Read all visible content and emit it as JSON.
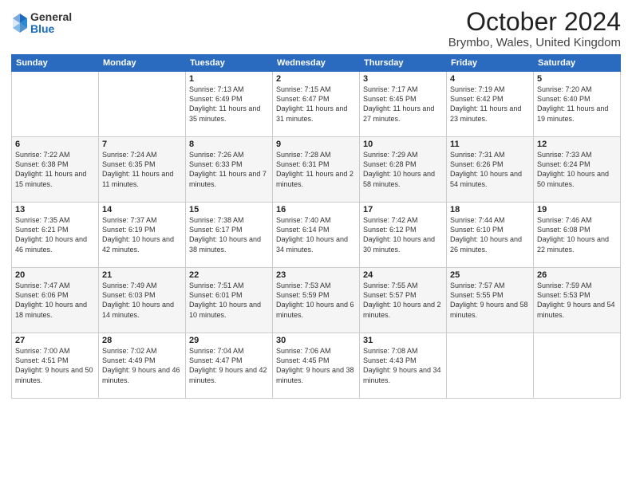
{
  "logo": {
    "general": "General",
    "blue": "Blue"
  },
  "header": {
    "title": "October 2024",
    "location": "Brymbo, Wales, United Kingdom"
  },
  "days": [
    "Sunday",
    "Monday",
    "Tuesday",
    "Wednesday",
    "Thursday",
    "Friday",
    "Saturday"
  ],
  "weeks": [
    [
      {
        "day": "",
        "content": ""
      },
      {
        "day": "",
        "content": ""
      },
      {
        "day": "1",
        "content": "Sunrise: 7:13 AM\nSunset: 6:49 PM\nDaylight: 11 hours and 35 minutes."
      },
      {
        "day": "2",
        "content": "Sunrise: 7:15 AM\nSunset: 6:47 PM\nDaylight: 11 hours and 31 minutes."
      },
      {
        "day": "3",
        "content": "Sunrise: 7:17 AM\nSunset: 6:45 PM\nDaylight: 11 hours and 27 minutes."
      },
      {
        "day": "4",
        "content": "Sunrise: 7:19 AM\nSunset: 6:42 PM\nDaylight: 11 hours and 23 minutes."
      },
      {
        "day": "5",
        "content": "Sunrise: 7:20 AM\nSunset: 6:40 PM\nDaylight: 11 hours and 19 minutes."
      }
    ],
    [
      {
        "day": "6",
        "content": "Sunrise: 7:22 AM\nSunset: 6:38 PM\nDaylight: 11 hours and 15 minutes."
      },
      {
        "day": "7",
        "content": "Sunrise: 7:24 AM\nSunset: 6:35 PM\nDaylight: 11 hours and 11 minutes."
      },
      {
        "day": "8",
        "content": "Sunrise: 7:26 AM\nSunset: 6:33 PM\nDaylight: 11 hours and 7 minutes."
      },
      {
        "day": "9",
        "content": "Sunrise: 7:28 AM\nSunset: 6:31 PM\nDaylight: 11 hours and 2 minutes."
      },
      {
        "day": "10",
        "content": "Sunrise: 7:29 AM\nSunset: 6:28 PM\nDaylight: 10 hours and 58 minutes."
      },
      {
        "day": "11",
        "content": "Sunrise: 7:31 AM\nSunset: 6:26 PM\nDaylight: 10 hours and 54 minutes."
      },
      {
        "day": "12",
        "content": "Sunrise: 7:33 AM\nSunset: 6:24 PM\nDaylight: 10 hours and 50 minutes."
      }
    ],
    [
      {
        "day": "13",
        "content": "Sunrise: 7:35 AM\nSunset: 6:21 PM\nDaylight: 10 hours and 46 minutes."
      },
      {
        "day": "14",
        "content": "Sunrise: 7:37 AM\nSunset: 6:19 PM\nDaylight: 10 hours and 42 minutes."
      },
      {
        "day": "15",
        "content": "Sunrise: 7:38 AM\nSunset: 6:17 PM\nDaylight: 10 hours and 38 minutes."
      },
      {
        "day": "16",
        "content": "Sunrise: 7:40 AM\nSunset: 6:14 PM\nDaylight: 10 hours and 34 minutes."
      },
      {
        "day": "17",
        "content": "Sunrise: 7:42 AM\nSunset: 6:12 PM\nDaylight: 10 hours and 30 minutes."
      },
      {
        "day": "18",
        "content": "Sunrise: 7:44 AM\nSunset: 6:10 PM\nDaylight: 10 hours and 26 minutes."
      },
      {
        "day": "19",
        "content": "Sunrise: 7:46 AM\nSunset: 6:08 PM\nDaylight: 10 hours and 22 minutes."
      }
    ],
    [
      {
        "day": "20",
        "content": "Sunrise: 7:47 AM\nSunset: 6:06 PM\nDaylight: 10 hours and 18 minutes."
      },
      {
        "day": "21",
        "content": "Sunrise: 7:49 AM\nSunset: 6:03 PM\nDaylight: 10 hours and 14 minutes."
      },
      {
        "day": "22",
        "content": "Sunrise: 7:51 AM\nSunset: 6:01 PM\nDaylight: 10 hours and 10 minutes."
      },
      {
        "day": "23",
        "content": "Sunrise: 7:53 AM\nSunset: 5:59 PM\nDaylight: 10 hours and 6 minutes."
      },
      {
        "day": "24",
        "content": "Sunrise: 7:55 AM\nSunset: 5:57 PM\nDaylight: 10 hours and 2 minutes."
      },
      {
        "day": "25",
        "content": "Sunrise: 7:57 AM\nSunset: 5:55 PM\nDaylight: 9 hours and 58 minutes."
      },
      {
        "day": "26",
        "content": "Sunrise: 7:59 AM\nSunset: 5:53 PM\nDaylight: 9 hours and 54 minutes."
      }
    ],
    [
      {
        "day": "27",
        "content": "Sunrise: 7:00 AM\nSunset: 4:51 PM\nDaylight: 9 hours and 50 minutes."
      },
      {
        "day": "28",
        "content": "Sunrise: 7:02 AM\nSunset: 4:49 PM\nDaylight: 9 hours and 46 minutes."
      },
      {
        "day": "29",
        "content": "Sunrise: 7:04 AM\nSunset: 4:47 PM\nDaylight: 9 hours and 42 minutes."
      },
      {
        "day": "30",
        "content": "Sunrise: 7:06 AM\nSunset: 4:45 PM\nDaylight: 9 hours and 38 minutes."
      },
      {
        "day": "31",
        "content": "Sunrise: 7:08 AM\nSunset: 4:43 PM\nDaylight: 9 hours and 34 minutes."
      },
      {
        "day": "",
        "content": ""
      },
      {
        "day": "",
        "content": ""
      }
    ]
  ]
}
